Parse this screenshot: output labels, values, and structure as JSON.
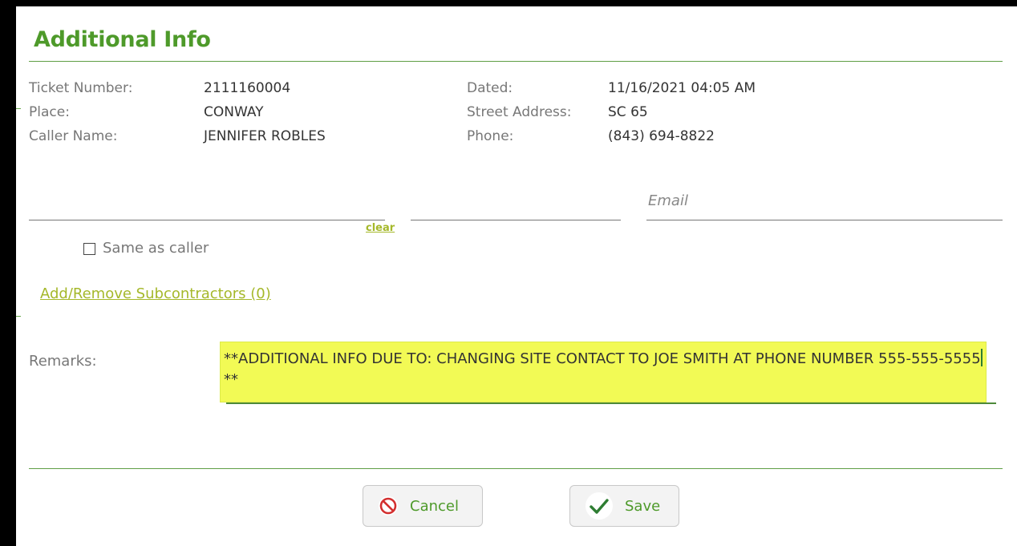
{
  "dialog": {
    "title": "Additional Info"
  },
  "ticket": {
    "ticket_number_label": "Ticket Number:",
    "ticket_number": "2111160004",
    "place_label": "Place:",
    "place": "CONWAY",
    "caller_name_label": "Caller Name:",
    "caller_name": "JENNIFER ROBLES",
    "dated_label": "Dated:",
    "dated": "11/16/2021 04:05 AM",
    "street_address_label": "Street Address:",
    "street_address": "SC 65",
    "phone_label": "Phone:",
    "phone": "(843) 694-8822"
  },
  "contact": {
    "name_value": "",
    "phone_value": "",
    "email_placeholder": "Email",
    "email_value": "",
    "clear_label": "clear",
    "same_as_caller_label": "Same as caller",
    "same_as_caller_checked": false
  },
  "subcontractors": {
    "link_label": "Add/Remove Subcontractors (0)"
  },
  "remarks": {
    "label": "Remarks:",
    "text_before_caret": "**ADDITIONAL INFO DUE TO: CHANGING SITE CONTACT TO JOE SMITH AT PHONE NUMBER 555-555-5555",
    "text_after_caret": "**",
    "highlight_color": "#f2fa55"
  },
  "buttons": {
    "cancel_label": "Cancel",
    "cancel_icon": "cancel-icon",
    "save_label": "Save",
    "save_icon": "checkmark-icon"
  },
  "colors": {
    "accent": "#4e9a2a",
    "link": "#a5b82a",
    "cancel_icon": "#d32f2f",
    "save_icon": "#2e7d32"
  }
}
